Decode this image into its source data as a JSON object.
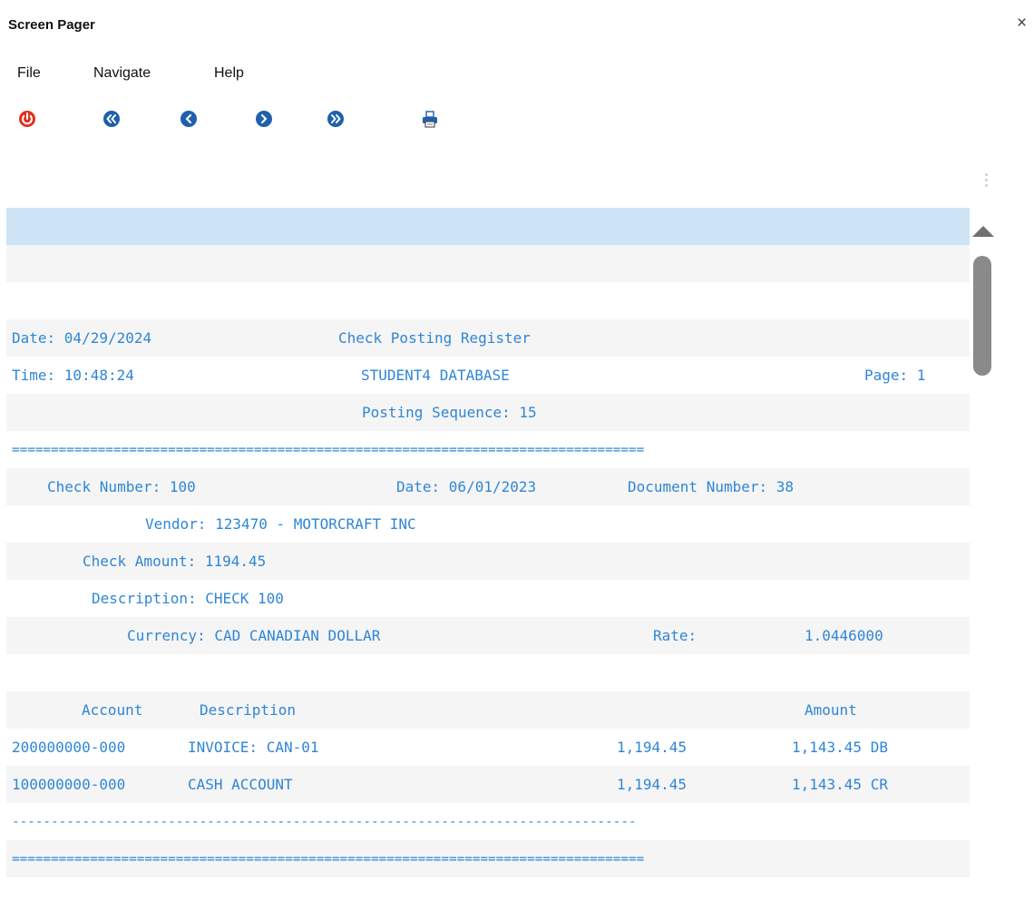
{
  "window": {
    "title": "Screen Pager",
    "close_label": "×"
  },
  "menu": [
    "File",
    "Navigate",
    "Help"
  ],
  "toolbar": {
    "icons": [
      "exit-icon",
      "first-page-icon",
      "previous-page-icon",
      "next-page-icon",
      "last-page-icon",
      "print-icon"
    ],
    "colors": {
      "exit": "#e0301e",
      "nav": "#1f5fae"
    }
  },
  "report": {
    "header": {
      "date": "Date: 04/29/2024",
      "title": "Check Posting Register",
      "time": "Time: 10:48:24",
      "database": "STUDENT4 DATABASE",
      "page": "Page: 1",
      "sequence": "Posting Sequence: 15"
    },
    "double_rule": "=================================================================================",
    "single_rule": "--------------------------------------------------------------------------------",
    "check": {
      "number": "Check Number: 100",
      "date": "Date: 06/01/2023",
      "document": "Document Number: 38",
      "vendor": "Vendor: 123470 - MOTORCRAFT INC",
      "amount": "Check Amount: 1194.45",
      "description": "Description: CHECK 100",
      "currency": "Currency: CAD CANADIAN DOLLAR",
      "rate_label": "Rate:",
      "rate_value": "1.0446000"
    },
    "columns": {
      "account": "Account",
      "description": "Description",
      "amount": "Amount"
    },
    "lines": [
      {
        "account": "200000000-000",
        "description": "INVOICE: CAN-01",
        "source_amount": "1,194.45",
        "amount": "1,143.45 DB"
      },
      {
        "account": "100000000-000",
        "description": "CASH ACCOUNT",
        "source_amount": "1,194.45",
        "amount": "1,143.45 CR"
      }
    ],
    "text_color": "#2f86d6",
    "selected_row_color": "#cde4f7"
  }
}
